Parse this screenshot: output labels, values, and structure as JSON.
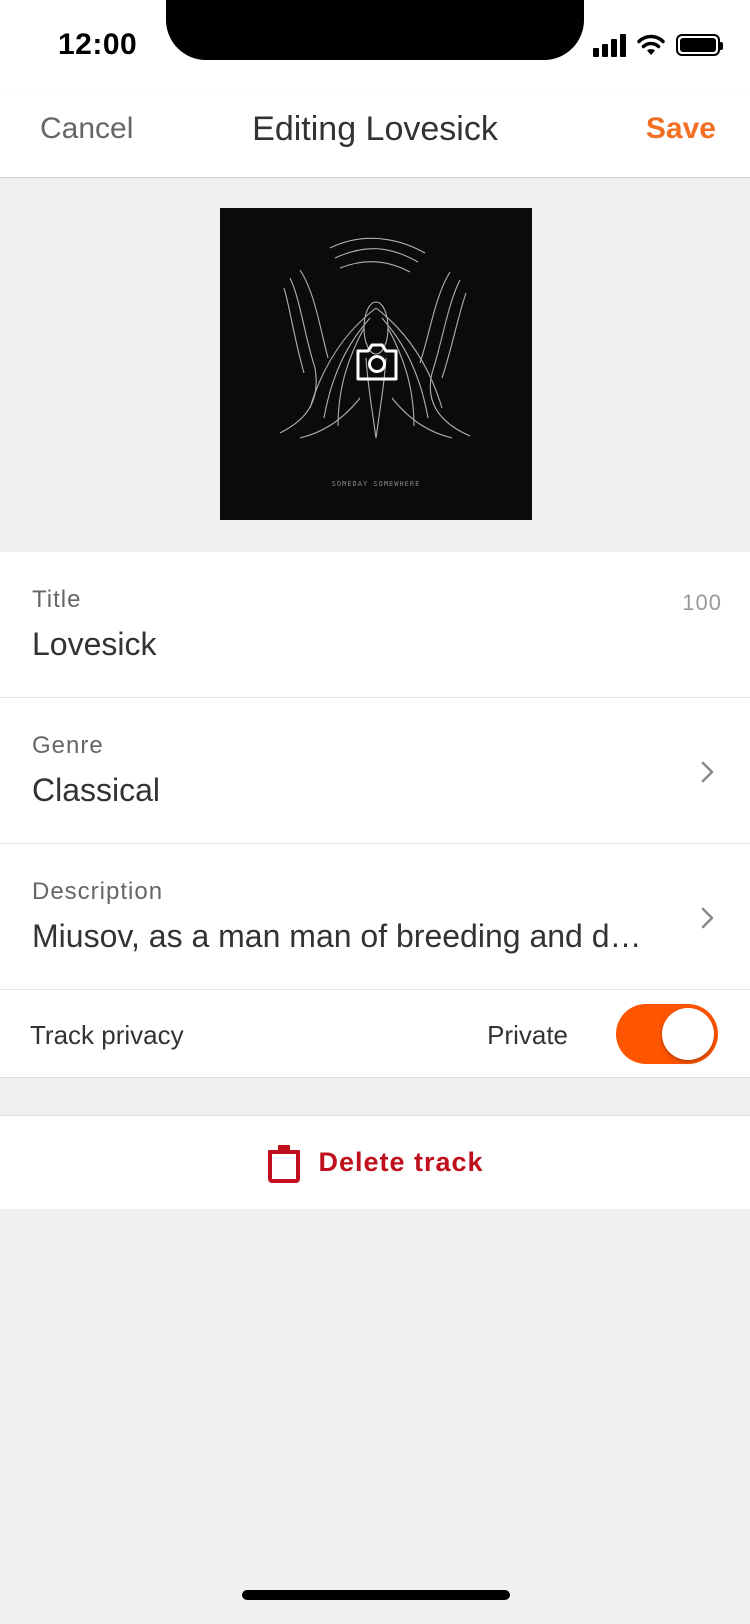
{
  "status_bar": {
    "time": "12:00"
  },
  "nav": {
    "cancel_label": "Cancel",
    "title": "Editing Lovesick",
    "save_label": "Save"
  },
  "artwork": {
    "caption": "SOMEDAY SOMEWHERE",
    "overlay_icon": "camera-icon"
  },
  "fields": {
    "title": {
      "label": "Title",
      "value": "Lovesick",
      "char_count": "100"
    },
    "genre": {
      "label": "Genre",
      "value": "Classical"
    },
    "description": {
      "label": "Description",
      "value": "Miusov, as a man man of breeding and d…"
    }
  },
  "privacy": {
    "label": "Track privacy",
    "status": "Private",
    "enabled": true
  },
  "delete": {
    "label": "Delete track"
  },
  "colors": {
    "accent": "#f26f23",
    "toggle_on": "#ff5500",
    "destructive": "#c0101e"
  }
}
